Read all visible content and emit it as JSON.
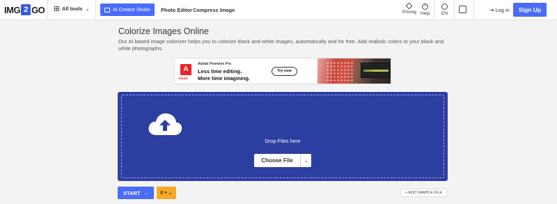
{
  "header": {
    "logo_left": "IMG",
    "logo_mid": "2",
    "logo_right": "GO",
    "all_tools_label": "All tools",
    "ai_creator_label": "AI Creator Studio",
    "photo_editor_label": "Photo Editor",
    "compress_image_label": "Compress Image",
    "pricing_label": "Pricing",
    "help_label": "Help",
    "language_label": "EN",
    "login_label": "Log in",
    "signup_label": "Sign Up"
  },
  "main": {
    "title": "Colorize Images Online",
    "description": "Our AI based image colorizer helps you to colorize black and white images, automatically and for free. Add realistic colors to your black and white photographs."
  },
  "ad": {
    "logo_letter": "A",
    "logo_label": "Adobe",
    "brand": "Adobe Premiere Pro",
    "line1": "Less time editing.",
    "line2": "More time imagining.",
    "cta": "Try now"
  },
  "upload": {
    "drop_text": "Drop Files here",
    "choose_file_label": "Choose File"
  },
  "actions": {
    "start_label": "START",
    "credits_value": "0",
    "add_sample_label": "+ ADD SAMPLE FILE"
  },
  "colors": {
    "accent": "#4a6cf7",
    "upload_bg": "#2d3ea1",
    "credits_bg": "#f7a928"
  }
}
